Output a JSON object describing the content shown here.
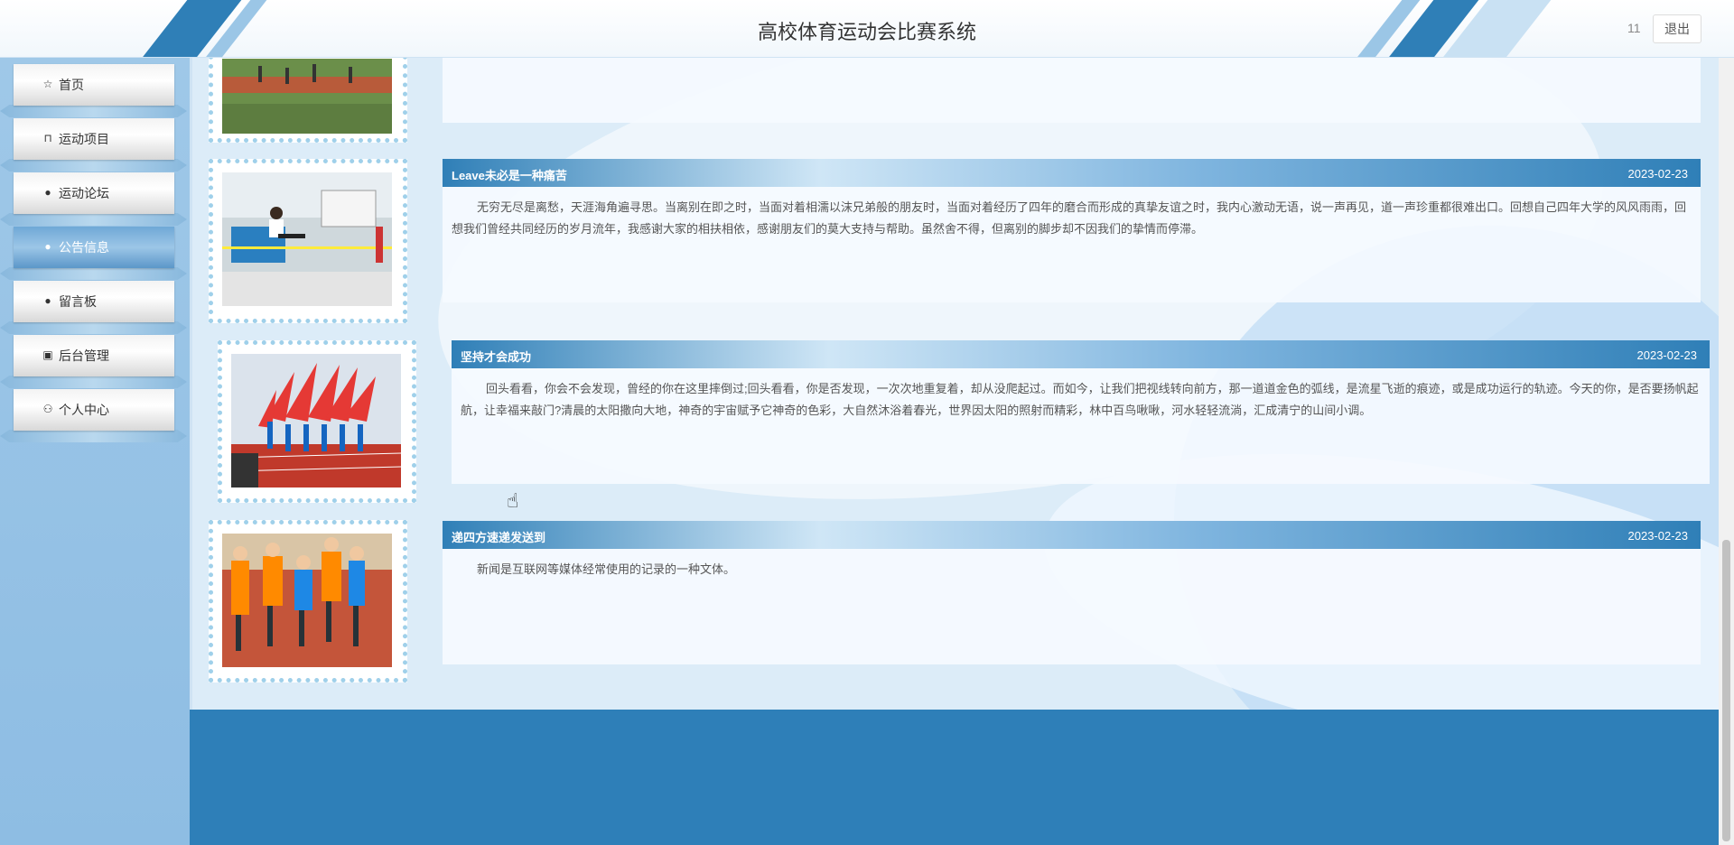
{
  "header": {
    "title": "高校体育运动会比赛系统",
    "user_label": "11",
    "logout_label": "退出"
  },
  "sidebar": {
    "items": [
      {
        "label": "首页",
        "icon": "star-icon",
        "glyph": "☆",
        "active": false
      },
      {
        "label": "运动项目",
        "icon": "bag-icon",
        "glyph": "⊓",
        "active": false
      },
      {
        "label": "运动论坛",
        "icon": "alert-icon",
        "glyph": "●",
        "active": false
      },
      {
        "label": "公告信息",
        "icon": "circle-icon",
        "glyph": "●",
        "active": true
      },
      {
        "label": "留言板",
        "icon": "info-icon",
        "glyph": "●",
        "active": false
      },
      {
        "label": "后台管理",
        "icon": "briefcase-icon",
        "glyph": "▣",
        "active": false
      },
      {
        "label": "个人中心",
        "icon": "user-icon",
        "glyph": "⚇",
        "active": false
      }
    ]
  },
  "news": [
    {
      "title": "Leave未必是一种痛苦",
      "date": "2023-02-23",
      "content": "无穷无尽是离愁，天涯海角遍寻思。当离别在即之时，当面对着相濡以沫兄弟般的朋友时，当面对着经历了四年的磨合而形成的真挚友谊之时，我内心激动无语，说一声再见，道一声珍重都很难出口。回想自己四年大学的风风雨雨，回想我们曾经共同经历的岁月流年，我感谢大家的相扶相依，感谢朋友们的莫大支持与帮助。虽然舍不得，但离别的脚步却不因我们的挚情而停滞。"
    },
    {
      "title": "坚持才会成功",
      "date": "2023-02-23",
      "content": "回头看看，你会不会发现，曾经的你在这里摔倒过;回头看看，你是否发现，一次次地重复着，却从没爬起过。而如今，让我们把视线转向前方，那一道道金色的弧线，是流星飞逝的痕迹，或是成功运行的轨迹。今天的你，是否要扬帆起航，让幸福来敲门?清晨的太阳撒向大地，神奇的宇宙赋予它神奇的色彩，大自然沐浴着春光，世界因太阳的照射而精彩，林中百鸟啾啾，河水轻轻流淌，汇成清宁的山间小调。"
    },
    {
      "title": "递四方速递发送到",
      "date": "2023-02-23",
      "content": "新闻是互联网等媒体经常使用的记录的一种文体。"
    }
  ],
  "colors": {
    "primary": "#2e7fb8",
    "sidebar": "#9fc8e8",
    "frame_dots": "#9fd0ea"
  }
}
